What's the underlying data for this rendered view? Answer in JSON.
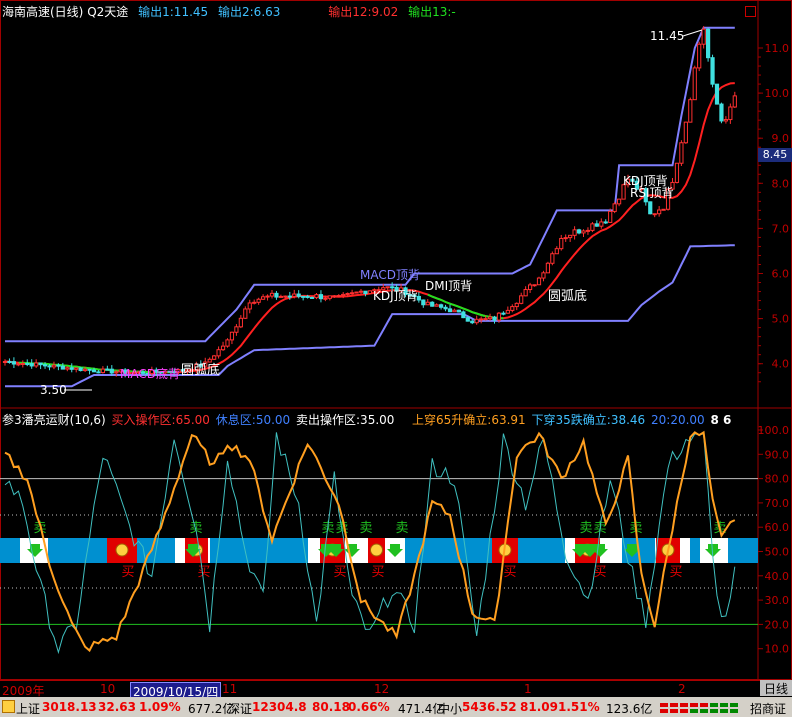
{
  "header": {
    "title": "海南高速(日线)",
    "indicator": "Q2天途",
    "output1": "输出1:11.45",
    "output2": "输出2:6.63",
    "output12": "输出12:9.02",
    "output13": "输出13:-"
  },
  "price_axis": {
    "labels": [
      "11.0",
      "10.0",
      "9.0",
      "8.0",
      "7.0",
      "6.0",
      "5.0",
      "4.0"
    ],
    "current_price": "8.45"
  },
  "main_annotations": {
    "high": "11.45",
    "low": "3.50",
    "kdj_top": "KDJ顶背",
    "rsi_top": "RSI顶背",
    "macd_top": "MACD顶背",
    "kdj_top2": "KDJ顶背",
    "dmi_top": "DMI顶背",
    "round_bottom1": "圆弧底",
    "round_bottom2": "圆弧底",
    "bottom_back": "MACD底背"
  },
  "indicator_panel": {
    "name": "参3潘亮运财(10,6)",
    "buy_zone": "买入操作区:65.00",
    "rest_zone": "休息区:50.00",
    "sell_zone": "卖出操作区:35.00",
    "up_cross": "上穿65升确立:63.91",
    "down_cross": "下穿35跌确立:38.46",
    "extra1": "20:20.00",
    "extra2": "8 6",
    "axis_labels": [
      "100.0",
      "90.0",
      "80.0",
      "70.0",
      "60.0",
      "50.0",
      "40.0",
      "30.0",
      "20.0",
      "10.0"
    ],
    "sell_label": "卖",
    "buy_label": "买"
  },
  "date_bar": {
    "year": "2009年",
    "m10": "10",
    "selected": "2009/10/15/四",
    "m11": "11",
    "m12": "12",
    "m1": "1",
    "m2": "2",
    "period": "日线"
  },
  "status_bar": {
    "sh_name": "上证",
    "sh_price": "3018.13",
    "sh_change": "32.63",
    "sh_pct": "1.09%",
    "sh_vol": "677.2亿",
    "sz_name": "深证",
    "sz_price": "12304.8",
    "sz_change": "80.18",
    "sz_pct": "0.66%",
    "sz_vol": "471.4亿",
    "zx_name": "中小",
    "zx_price": "5436.52",
    "zx_change": "81.09",
    "zx_pct": "1.51%",
    "zx_vol": "123.6亿",
    "broker": "招商证"
  },
  "colors": {
    "up": "#ff3030",
    "down": "#40e0e0",
    "bands": "#8080ff",
    "ma_red": "#ff2020",
    "ma_green": "#20e020",
    "kd_orange": "#ff9f20",
    "kd_cyan": "#40c0c0",
    "strip_blue": "#0090d0",
    "strip_red": "#e00000"
  }
}
